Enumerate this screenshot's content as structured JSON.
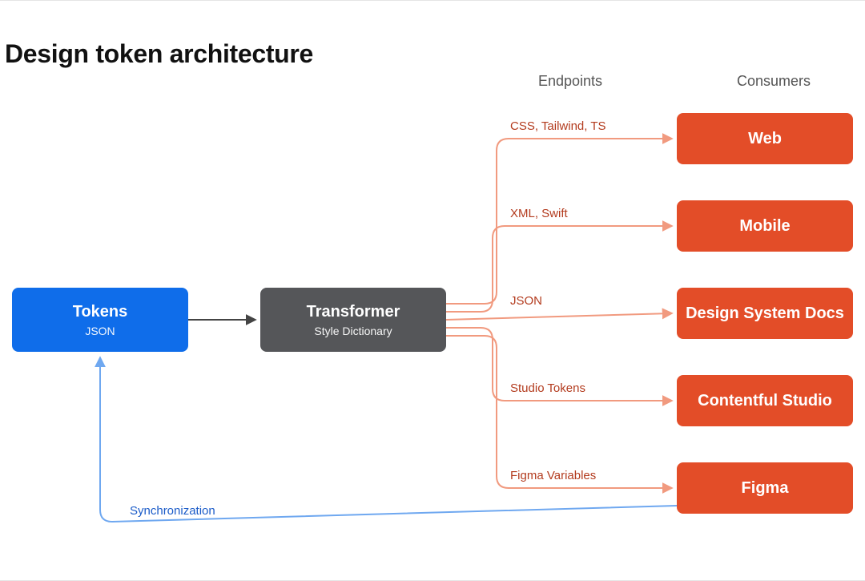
{
  "title": "Design token architecture",
  "column_headers": {
    "endpoints": "Endpoints",
    "consumers": "Consumers"
  },
  "nodes": {
    "tokens": {
      "title": "Tokens",
      "subtitle": "JSON"
    },
    "transformer": {
      "title": "Transformer",
      "subtitle": "Style Dictionary"
    }
  },
  "endpoints": [
    {
      "label": "CSS, Tailwind, TS"
    },
    {
      "label": "XML, Swift"
    },
    {
      "label": "JSON"
    },
    {
      "label": "Studio Tokens"
    },
    {
      "label": "Figma Variables"
    }
  ],
  "consumers": [
    {
      "label": "Web"
    },
    {
      "label": "Mobile"
    },
    {
      "label": "Design System Docs"
    },
    {
      "label": "Contentful Studio"
    },
    {
      "label": "Figma"
    }
  ],
  "sync_label": "Synchronization",
  "colors": {
    "tokens_bg": "#0F6DEA",
    "transformer_bg": "#555659",
    "consumer_bg": "#E34D28",
    "endpoint_text": "#B33B1E",
    "sync_arrow": "#6FA8F0",
    "orange_arrow": "#F19A7F",
    "dark_arrow": "#444"
  },
  "chart_data": {
    "type": "diagram",
    "title": "Design token architecture",
    "nodes": [
      {
        "id": "tokens",
        "label": "Tokens",
        "meta": "JSON"
      },
      {
        "id": "transformer",
        "label": "Transformer",
        "meta": "Style Dictionary"
      },
      {
        "id": "web",
        "label": "Web",
        "group": "Consumers"
      },
      {
        "id": "mobile",
        "label": "Mobile",
        "group": "Consumers"
      },
      {
        "id": "dsdocs",
        "label": "Design System Docs",
        "group": "Consumers"
      },
      {
        "id": "studio",
        "label": "Contentful Studio",
        "group": "Consumers"
      },
      {
        "id": "figma",
        "label": "Figma",
        "group": "Consumers"
      }
    ],
    "edges": [
      {
        "from": "tokens",
        "to": "transformer",
        "label": ""
      },
      {
        "from": "transformer",
        "to": "web",
        "label": "CSS, Tailwind, TS",
        "group": "Endpoints"
      },
      {
        "from": "transformer",
        "to": "mobile",
        "label": "XML, Swift",
        "group": "Endpoints"
      },
      {
        "from": "transformer",
        "to": "dsdocs",
        "label": "JSON",
        "group": "Endpoints"
      },
      {
        "from": "transformer",
        "to": "studio",
        "label": "Studio Tokens",
        "group": "Endpoints"
      },
      {
        "from": "transformer",
        "to": "figma",
        "label": "Figma Variables",
        "group": "Endpoints"
      },
      {
        "from": "figma",
        "to": "tokens",
        "label": "Synchronization"
      }
    ]
  }
}
